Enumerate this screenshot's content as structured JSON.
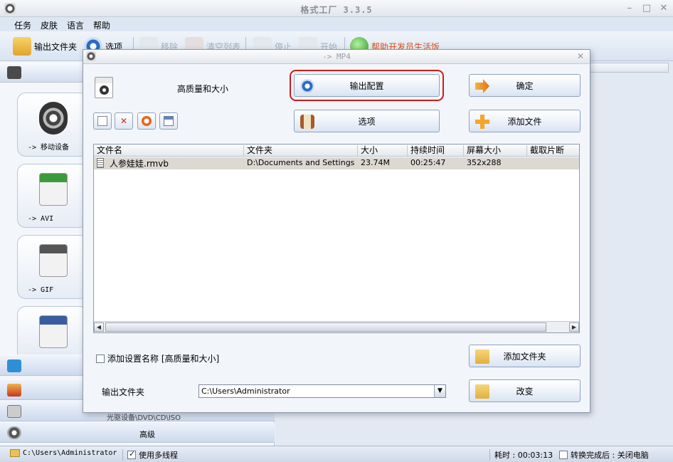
{
  "window": {
    "title": "格式工厂 3.3.5"
  },
  "menu": {
    "items": [
      "任务",
      "皮肤",
      "语言",
      "帮助"
    ]
  },
  "toolbar": {
    "output_folder": "输出文件夹",
    "options": "选项",
    "remove": "移除",
    "clear_list": "清空列表",
    "stop": "停止",
    "start": "开始",
    "promo": "帮助开发员生活饭"
  },
  "left_panel": {
    "categories": {
      "audio_icon": "music-note-icon",
      "picture_icon": "picture-icon",
      "rom_icon": "disc-drive-icon",
      "advanced_label": "高级",
      "rom_label": "光驱设备\\DVD\\CD\\ISO"
    },
    "formats": [
      {
        "label": "-> 移动设备",
        "icon": "film-reel-icon"
      },
      {
        "label": "-> AVI",
        "icon": "avi-file-icon"
      },
      {
        "label": "-> GIF",
        "icon": "gif-file-icon"
      },
      {
        "label": "",
        "icon": "mpeg-file-icon"
      }
    ]
  },
  "dialog": {
    "title": "-> MP4",
    "preset_name": "高质量和大小",
    "buttons": {
      "output_config": "输出配置",
      "ok": "确定",
      "options": "选项",
      "add_file": "添加文件",
      "add_folder": "添加文件夹",
      "change": "改变"
    },
    "table": {
      "headers": [
        "文件名",
        "文件夹",
        "大小",
        "持续时间",
        "屏幕大小",
        "截取片断"
      ],
      "rows": [
        {
          "name": "人参娃娃.rmvb",
          "folder": "D:\\Documents and Settings\\...",
          "size": "23.74M",
          "duration": "00:25:47",
          "screen": "352x288",
          "clip": ""
        }
      ]
    },
    "add_setting_name": "添加设置名称 [高质量和大小]",
    "output_folder_label": "输出文件夹",
    "output_folder_value": "C:\\Users\\Administrator"
  },
  "statusbar": {
    "path": "C:\\Users\\Administrator",
    "multithread": "使用多线程",
    "elapsed_label": "耗时 : 00:03:13",
    "after_convert": "转换完成后 : 关闭电脑"
  },
  "colors": {
    "highlight": "#d11a1a",
    "accent": "#3b78c9"
  }
}
